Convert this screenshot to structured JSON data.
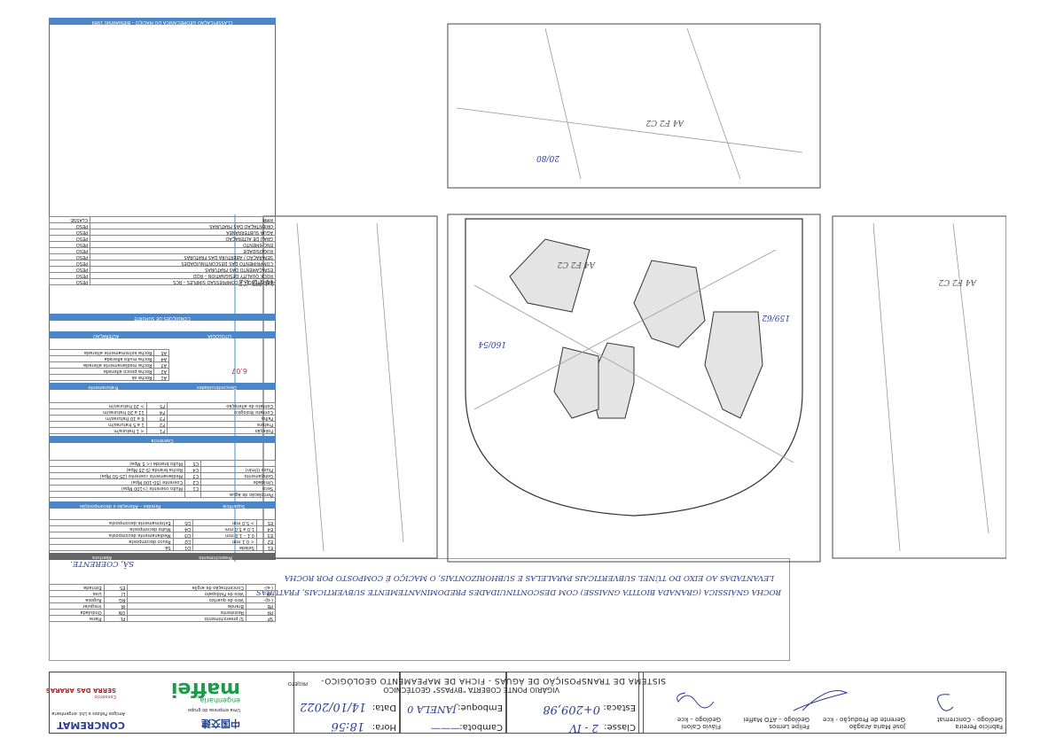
{
  "header": {
    "client": "CONCREMAT",
    "client_sub": "Amigos Felizes e Ltd. engenharia",
    "consortium": "SERRA DAS ARARAS",
    "consortium_pre": "Consórcio",
    "partner_cn": "中国交建",
    "partner_sub": "Uma empresa do grupo",
    "maffei": "maffei",
    "maffei_sub": "engenharia",
    "hora_label": "Hora:",
    "hora_value": "18:56",
    "data_label": "Data:",
    "data_value": "14/10/2022",
    "camboto_label": "Cambota:",
    "camboto_value": "———",
    "emboque_label": "Emboque:",
    "emboque_value": "JANELA 0",
    "classe_label": "Classe:",
    "classe_value": "2 - IV",
    "estaca_label": "Estaca:",
    "estaca_value": "0+209,98",
    "projeto_label": "PROJETO:",
    "projeto_line1": "SISTEMA DE TRANSPOSIÇÃO DE ÁGUAS - FICHA DE MAPEAMENTO GEOLÓGICO-",
    "projeto_line2": "VIGÁRIO PONTE COBERTA \"BYPASS\" GEOTÉCNICO"
  },
  "signatures": {
    "sig1_name": "Flávio Caloni",
    "sig1_role": "Geólogo – kce",
    "sig2_name": "Felipe Lemos",
    "sig2_role": "Geólogo – ATO Maffei",
    "sig3_name": "José Maria Aragão",
    "sig3_role": "Gerente de Produção - kce",
    "sig4_name": "Fabrício Pereira",
    "sig4_role": "Geólogo - Concremat"
  },
  "description": {
    "line1": "ROCHA GNÁISSICA (GRANADA BIOTITA GNAISSE) COM DESCONTINUIDADES PREDOMINANTEMENTE SUBVERTICAIS, FRATURAS",
    "line2": "LEVANTADAS AO EIXO DO TÚNEL SUBVERTICAIS PARALELAS E SUBHORIZONTAIS, O MACIÇO É COMPOSTO POR ROCHA",
    "line3": "SÃ, COERENTE."
  },
  "drawing": {
    "dip_label": "6.07",
    "annotations": [
      "A4 F2 C2",
      "A4 F2 C2",
      "A4 F2 C2",
      "A4 F2 C2",
      "160/54",
      "159/62",
      "20/80"
    ]
  },
  "legend": {
    "litologia_title": "LITOLOGIA",
    "alteracao_title": "ALTERAÇÃO",
    "alteracao_rows": [
      [
        "A1",
        "Rocha sã"
      ],
      [
        "A2",
        "Rocha pouco alterada"
      ],
      [
        "A3",
        "Rocha medianamente alterada"
      ],
      [
        "A4",
        "Rocha muito alterada"
      ],
      [
        "A5",
        "Rocha extremamente alterada"
      ]
    ],
    "descontinuidades_title": "Descontinuidades",
    "fraturamento_title": "Fraturamento",
    "fraturamento_rows": [
      [
        "Foliação",
        "F1",
        "< 1 fratura/m"
      ],
      [
        "Fratura",
        "F2",
        "1 a 5 fraturas/m"
      ],
      [
        "Falha",
        "F3",
        "6 a 10 fraturas/m"
      ],
      [
        "Contato litológico",
        "F4",
        "11 a 20 fraturas/m"
      ],
      [
        "Contato de alteração",
        "F5",
        "> 20 fraturas/m"
      ]
    ],
    "coerencia_title": "Coerência",
    "coerencia_rows": [
      [
        "Percolação de água",
        "",
        ""
      ],
      [
        "Seco",
        "C1",
        "Muito coerente (>100 Mpa)"
      ],
      [
        "Umidade",
        "C2",
        "Coerente (50-100 Mpa)"
      ],
      [
        "Gotejamento",
        "C3",
        "Medianamente coerente (25-50 Mpa)"
      ],
      [
        "Fluxo (l/min)",
        "C4",
        "Rocha branda (5-25 Mpa)"
      ],
      [
        "",
        "C5",
        "Muito branda (< 5 Mpa)"
      ]
    ],
    "superficie_title": "Superfície",
    "paredes_title": "Paredes – Alteração e decomposição",
    "superficie_rows": [
      [
        "E1",
        "Selada",
        "D1",
        "Sã"
      ],
      [
        "E2",
        "< 0,1 mm",
        "D2",
        "Pouco decomposta"
      ],
      [
        "E3",
        "0,1 – 1,0 mm",
        "D3",
        "Medianamente decomposta"
      ],
      [
        "E4",
        "1,0 a 5,0 mm",
        "D4",
        "Muito decomposta"
      ],
      [
        "E5",
        "> 5,0 mm",
        "D5",
        "Extremamente decomposta"
      ]
    ],
    "preenchimento_title": "Preenchimento",
    "abertura_title": "Abertura",
    "preenchimento_rows": [
      [
        "SP",
        "S/ preenchimento",
        "PL",
        "Plana"
      ],
      [
        "PR",
        "Resistente",
        "ON",
        "Ondulada"
      ],
      [
        "PB",
        "Branda",
        "IR",
        "Irregular"
      ],
      [
        "(-q)-",
        "Veio de quartzo",
        "RG",
        "Rugosa"
      ],
      [
        "(-f)-",
        "Veio de Feldspato",
        "LI",
        "Lisa"
      ],
      [
        "(-a)-",
        "Concentração de argila",
        "ES",
        "Estriada"
      ]
    ]
  },
  "classification": {
    "title": "CLASSIFICAÇÃO GEOMECÂNICA DO MACIÇO – BIENIAWSKI 1989",
    "rows": [
      "RESISTÊNCIA À COMPRESSÃO SIMPLES – RCS",
      "ROCK QUALITY DESIGNATION – RQD",
      "ESPAÇAMENTO DAS FRATURAS",
      "COMPRIMENTO DAS DESCONTINUIDADES",
      "SEPARAÇÃO / ABERTURA DAS FRATURAS",
      "RUGOSIDADE",
      "ENCHIMENTO",
      "GRAU DE ALTERAÇÃO",
      "ÁGUA SUBTERRÂNEA",
      "ORIENTAÇÃO DAS FRATURAS"
    ],
    "peso_label": "PESO",
    "rmr_label": "RMR:",
    "classe_label": "CLASSE:",
    "condicoes_label": "CONDIÇÕES DE SUPORTE"
  }
}
